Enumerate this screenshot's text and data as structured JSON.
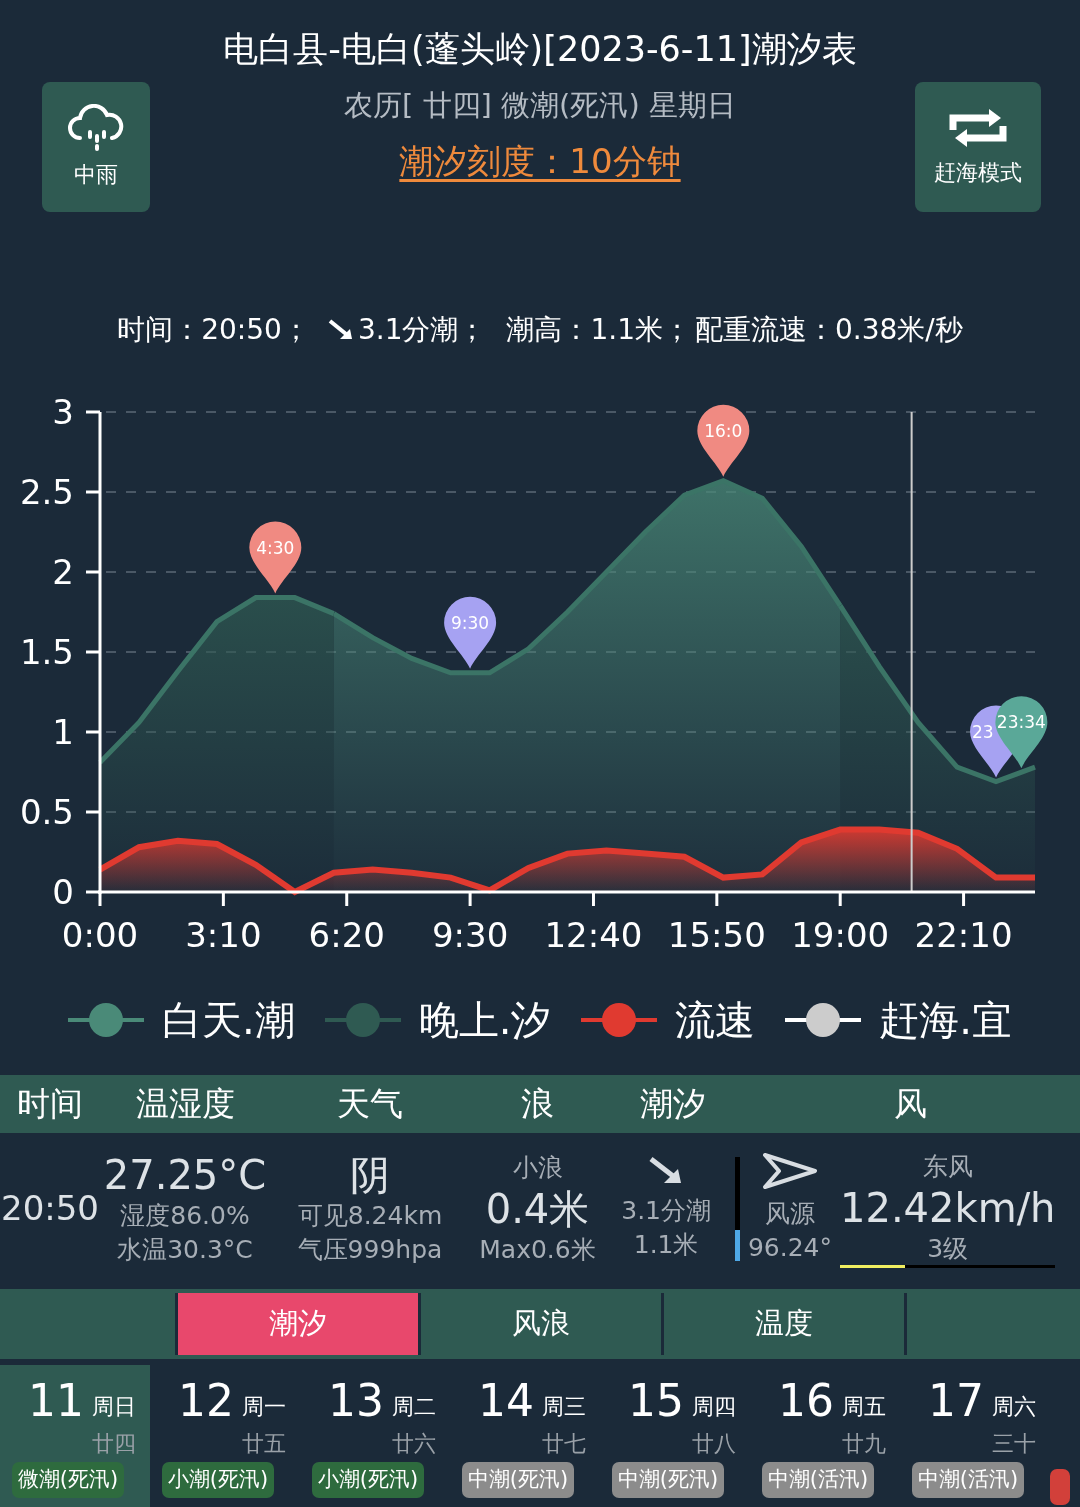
{
  "header": {
    "title": "电白县-电白(蓬头岭)[2023-6-11]潮汐表",
    "subtitle": "农历[ 廿四] 微潮(死汛) 星期日",
    "scale_link": "潮汐刻度：10分钟"
  },
  "weather_button": {
    "label": "中雨"
  },
  "mode_button": {
    "label": "赶海模式"
  },
  "info": {
    "time": "时间：20:50；",
    "tide": "3.1分潮；",
    "height": "潮高：1.1米；",
    "speed": "配重流速：0.38米/秒"
  },
  "chart": {
    "chart_data": {
      "type": "area",
      "x": [
        0,
        60,
        120,
        180,
        240,
        300,
        360,
        420,
        480,
        540,
        600,
        660,
        720,
        780,
        840,
        900,
        960,
        1020,
        1080,
        1140,
        1200,
        1260,
        1320,
        1380,
        1440
      ],
      "xlim": [
        0,
        1440
      ],
      "ylim": [
        0,
        3
      ],
      "xticks": [
        {
          "value": 0,
          "label": "0:00"
        },
        {
          "value": 190,
          "label": "3:10"
        },
        {
          "value": 380,
          "label": "6:20"
        },
        {
          "value": 570,
          "label": "9:30"
        },
        {
          "value": 760,
          "label": "12:40"
        },
        {
          "value": 950,
          "label": "15:50"
        },
        {
          "value": 1140,
          "label": "19:00"
        },
        {
          "value": 1330,
          "label": "22:10"
        }
      ],
      "yticks": [
        {
          "value": 0,
          "label": "0"
        },
        {
          "value": 0.5,
          "label": "0.5"
        },
        {
          "value": 1,
          "label": "1"
        },
        {
          "value": 1.5,
          "label": "1.5"
        },
        {
          "value": 2,
          "label": "2"
        },
        {
          "value": 2.5,
          "label": "2.5"
        },
        {
          "value": 3,
          "label": "3"
        }
      ],
      "series": [
        {
          "name": "白天.潮",
          "color": "#4a8a78",
          "values": [
            null,
            null,
            null,
            null,
            null,
            null,
            1.74,
            1.59,
            1.46,
            1.37,
            1.37,
            1.52,
            1.75,
            2.0,
            2.25,
            2.48,
            2.57,
            2.46,
            2.16,
            1.79,
            null,
            null,
            null,
            null,
            null
          ]
        },
        {
          "name": "晚上.汐",
          "color": "#2f5a52",
          "values": [
            0.81,
            1.06,
            1.38,
            1.69,
            1.84,
            1.84,
            1.74,
            null,
            null,
            null,
            null,
            null,
            null,
            null,
            null,
            null,
            null,
            null,
            null,
            1.79,
            1.41,
            1.06,
            0.78,
            0.69,
            0.78
          ]
        },
        {
          "name": "流速",
          "color": "#e03a30",
          "values": [
            0.14,
            0.28,
            0.32,
            0.3,
            0.17,
            0,
            0.12,
            0.14,
            0.12,
            0.09,
            0.01,
            0.15,
            0.24,
            0.26,
            0.24,
            0.22,
            0.09,
            0.11,
            0.31,
            0.39,
            0.39,
            0.37,
            0.27,
            0.09,
            0.09
          ]
        }
      ],
      "grid": true,
      "ref_lines": [
        {
          "axis": "x",
          "value": 1250,
          "label": "赶海.宜",
          "color": "#cccccc"
        }
      ]
    },
    "markers": [
      {
        "label": "4:30",
        "color": "#f08a82"
      },
      {
        "label": "9:30",
        "color": "#a6a2f2"
      },
      {
        "label": "16:0",
        "color": "#f08a82"
      },
      {
        "label": "23",
        "color": "#a6a2f2"
      },
      {
        "label": "23:34",
        "color": "#5aa898"
      }
    ]
  },
  "table": {
    "columns": [
      "时间",
      "温湿度",
      "天气",
      "浪",
      "潮汐",
      "风"
    ],
    "row": {
      "time": "20:50",
      "temperature": "27.25°C",
      "humidity": "湿度86.0%",
      "water_temp": "水温30.3°C",
      "weather": "阴",
      "visibility": "可见8.24km",
      "pressure": "气压999hpa",
      "wave_type": "小浪",
      "wave_height": "0.4米",
      "wave_max": "Max0.6米",
      "tide": "3.1分潮",
      "tide_height": "1.1米",
      "tide_bar": {
        "level": 0.3
      },
      "wind_source": "风源",
      "wind_angle": "96.24°",
      "wind_dir": "东风",
      "wind_speed": "12.42km/h",
      "wind_grade": "3级",
      "wind_bar": {
        "level": 0.3
      }
    }
  },
  "tabs": [
    {
      "label": "潮汐",
      "selected": true
    },
    {
      "label": "风浪",
      "selected": false
    },
    {
      "label": "温度",
      "selected": false
    }
  ],
  "days": [
    {
      "date": "11",
      "weekday": "周日",
      "lunar": "廿四",
      "tag": "微潮(死汛)",
      "color": "#2e6b3e",
      "selected": true
    },
    {
      "date": "12",
      "weekday": "周一",
      "lunar": "廿五",
      "tag": "小潮(死汛)",
      "color": "#2e6b3e",
      "selected": false
    },
    {
      "date": "13",
      "weekday": "周二",
      "lunar": "廿六",
      "tag": "小潮(死汛)",
      "color": "#2e6b3e",
      "selected": false
    },
    {
      "date": "14",
      "weekday": "周三",
      "lunar": "廿七",
      "tag": "中潮(死汛)",
      "color": "#8c8c8c",
      "selected": false
    },
    {
      "date": "15",
      "weekday": "周四",
      "lunar": "廿八",
      "tag": "中潮(死汛)",
      "color": "#8c8c8c",
      "selected": false
    },
    {
      "date": "16",
      "weekday": "周五",
      "lunar": "廿九",
      "tag": "中潮(活汛)",
      "color": "#8c8c8c",
      "selected": false
    },
    {
      "date": "17",
      "weekday": "周六",
      "lunar": "三十",
      "tag": "中潮(活汛)",
      "color": "#8c8c8c",
      "selected": false
    },
    {
      "color": "#d2403a"
    }
  ]
}
